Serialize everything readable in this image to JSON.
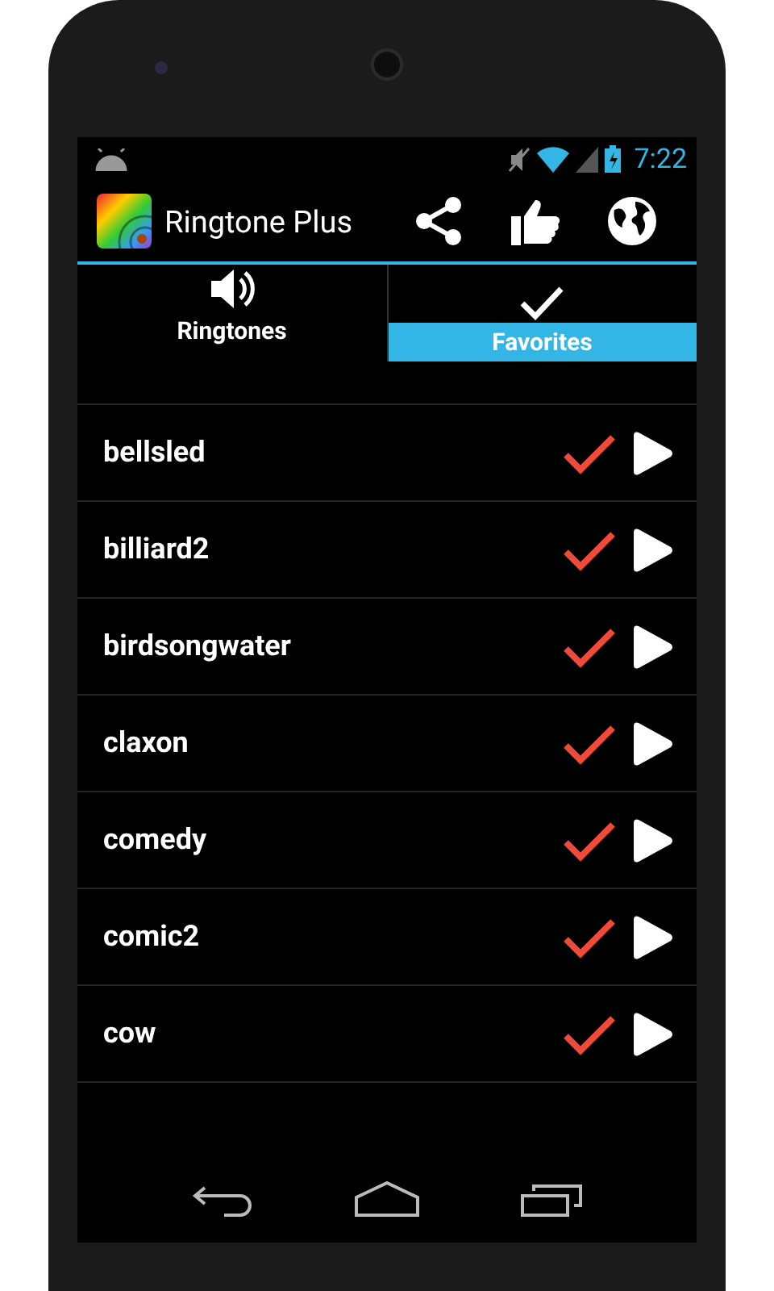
{
  "status_bar": {
    "time": "7:22"
  },
  "action_bar": {
    "title": "Ringtone Plus"
  },
  "tabs": [
    {
      "kind": "speaker",
      "label": "Ringtones",
      "selected": false
    },
    {
      "kind": "check",
      "label": "Favorites",
      "selected": true
    }
  ],
  "ringtones": [
    {
      "name": "bellsled",
      "favorite": true
    },
    {
      "name": "billiard2",
      "favorite": true
    },
    {
      "name": "birdsongwater",
      "favorite": true
    },
    {
      "name": "claxon",
      "favorite": true
    },
    {
      "name": "comedy",
      "favorite": true
    },
    {
      "name": "comic2",
      "favorite": true
    },
    {
      "name": "cow",
      "favorite": true
    }
  ]
}
